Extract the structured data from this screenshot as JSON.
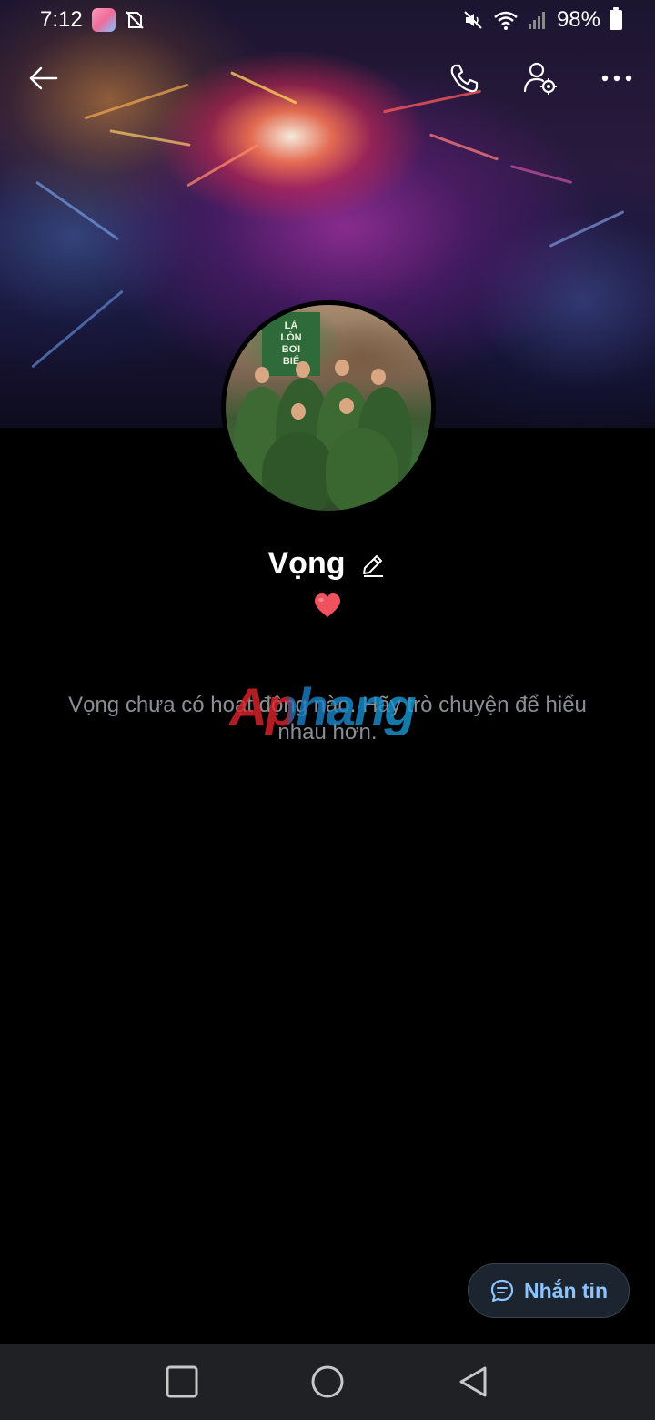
{
  "status_bar": {
    "time": "7:12",
    "battery": "98%"
  },
  "profile": {
    "name": "Vọng",
    "status_emoji": "heart-icon",
    "avatar_sign_lines": [
      "LÀ",
      "LÒN",
      "BƠI",
      "BIỂ"
    ]
  },
  "empty_state": {
    "message": "Vọng chưa có hoạt động nào. Hãy trò chuyện để hiểu nhau hơn."
  },
  "watermark": {
    "text": "Aphang"
  },
  "fab": {
    "label": "Nhắn tin"
  },
  "colors": {
    "background": "#000000",
    "accent": "#8cc4ff",
    "muted_text": "#8a8f96",
    "fab_bg": "#1c2430",
    "nav_bg": "#202124",
    "heart": "#f0515f"
  },
  "icons": {
    "back": "back-arrow-icon",
    "call": "phone-icon",
    "settings": "user-settings-icon",
    "more": "more-dots-icon",
    "edit": "pencil-icon",
    "message": "chat-bubble-icon",
    "nav_recents": "square-icon",
    "nav_home": "circle-icon",
    "nav_back": "triangle-back-icon"
  }
}
